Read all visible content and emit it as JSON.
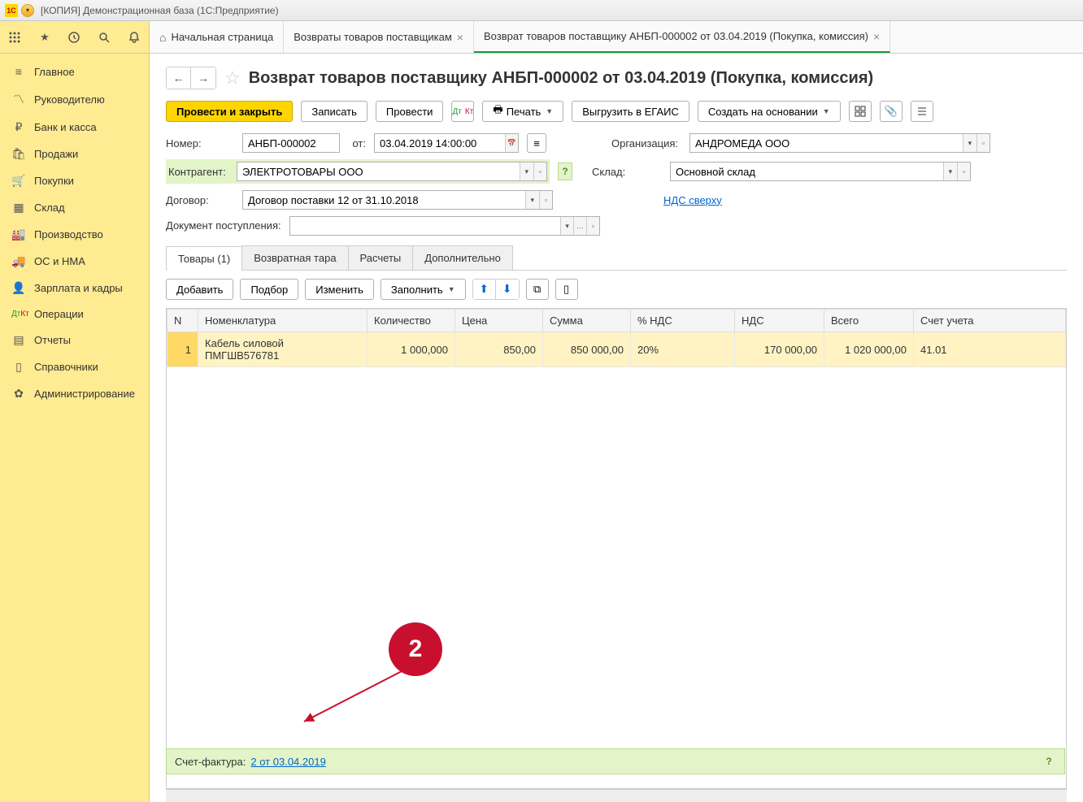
{
  "window": {
    "title": "[КОПИЯ] Демонстрационная база  (1С:Предприятие)"
  },
  "tabs": {
    "home": "Начальная страница",
    "list": "Возвраты товаров поставщикам",
    "doc": "Возврат товаров поставщику АНБП-000002 от 03.04.2019 (Покупка, комиссия)"
  },
  "sidebar": {
    "items": [
      "Главное",
      "Руководителю",
      "Банк и касса",
      "Продажи",
      "Покупки",
      "Склад",
      "Производство",
      "ОС и НМА",
      "Зарплата и кадры",
      "Операции",
      "Отчеты",
      "Справочники",
      "Администрирование"
    ]
  },
  "page": {
    "title": "Возврат товаров поставщику АНБП-000002 от 03.04.2019 (Покупка, комиссия)"
  },
  "actions": {
    "post_close": "Провести и закрыть",
    "save": "Записать",
    "post": "Провести",
    "print": "Печать",
    "egais": "Выгрузить в ЕГАИС",
    "create_based": "Создать на основании"
  },
  "form": {
    "number_lbl": "Номер:",
    "number_val": "АНБП-000002",
    "from_lbl": "от:",
    "date_val": "03.04.2019 14:00:00",
    "org_lbl": "Организация:",
    "org_val": "АНДРОМЕДА ООО",
    "contragent_lbl": "Контрагент:",
    "contragent_val": "ЭЛЕКТРОТОВАРЫ ООО",
    "sklad_lbl": "Склад:",
    "sklad_val": "Основной склад",
    "dogovor_lbl": "Договор:",
    "dogovor_val": "Договор поставки 12 от 31.10.2018",
    "nds_link": "НДС сверху",
    "docpost_lbl": "Документ поступления:"
  },
  "inner_tabs": {
    "goods": "Товары (1)",
    "tara": "Возвратная тара",
    "calc": "Расчеты",
    "extra": "Дополнительно"
  },
  "tbl_actions": {
    "add": "Добавить",
    "pick": "Подбор",
    "edit": "Изменить",
    "fill": "Заполнить"
  },
  "grid": {
    "cols": [
      "N",
      "Номенклатура",
      "Количество",
      "Цена",
      "Сумма",
      "% НДС",
      "НДС",
      "Всего",
      "Счет учета"
    ],
    "row": {
      "n": "1",
      "nomen": "Кабель силовой ПМГШВ576781",
      "qty": "1 000,000",
      "price": "850,00",
      "sum": "850 000,00",
      "vatp": "20%",
      "vat": "170 000,00",
      "total": "1 020 000,00",
      "acct": "41.01"
    }
  },
  "footer": {
    "lbl": "Счет-фактура:",
    "link": "2 от 03.04.2019"
  },
  "annotation": {
    "num": "2"
  }
}
